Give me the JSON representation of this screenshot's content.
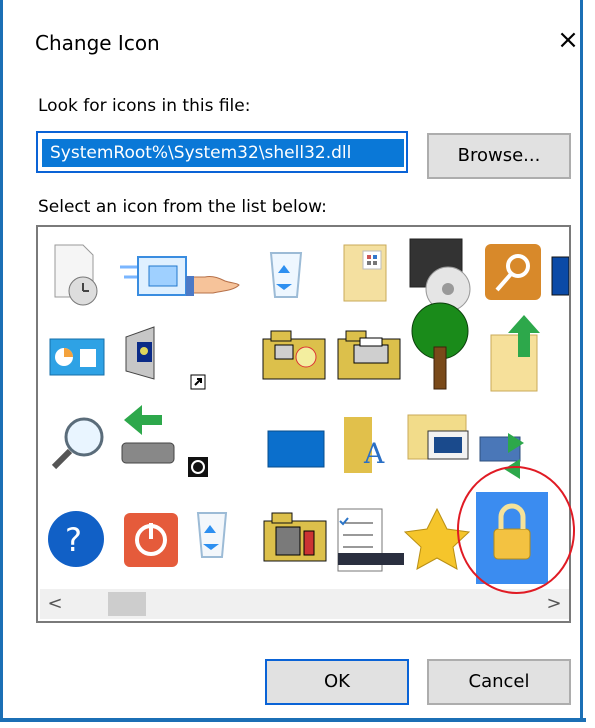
{
  "dialog": {
    "title": "Change Icon",
    "close_label": "×"
  },
  "file": {
    "label": "Look for icons in this file:",
    "path": "SystemRoot%\\System32\\shell32.dll",
    "browse_label": "Browse..."
  },
  "list": {
    "label": "Select an icon from the list below:",
    "icons": [
      "clock-document-icon",
      "monitor-icon",
      "hand-share-icon",
      "recycle-bin-icon",
      "calculator-file-icon",
      "media-disc-icon",
      "key-icon",
      "partial-monitor-icon",
      "control-panel-icon",
      "speaker-monitor-icon",
      "shortcut-arrow-icon",
      "network-folder-icon",
      "printer-folder-icon",
      "tree-icon",
      "upload-file-icon",
      "magnifier-icon",
      "usb-arrow-icon",
      "clock-badge-icon",
      "desktop-window-icon",
      "font-folder-icon",
      "computer-folder-icon",
      "sync-monitor-icon",
      "help-icon",
      "power-icon",
      "recycle-bin-empty-icon",
      "tools-folder-icon",
      "task-list-icon",
      "star-icon",
      "lock-icon"
    ],
    "selected_icon": "lock-icon"
  },
  "scrollbar": {
    "left_arrow": "<",
    "right_arrow": ">"
  },
  "buttons": {
    "ok": "OK",
    "cancel": "Cancel"
  }
}
